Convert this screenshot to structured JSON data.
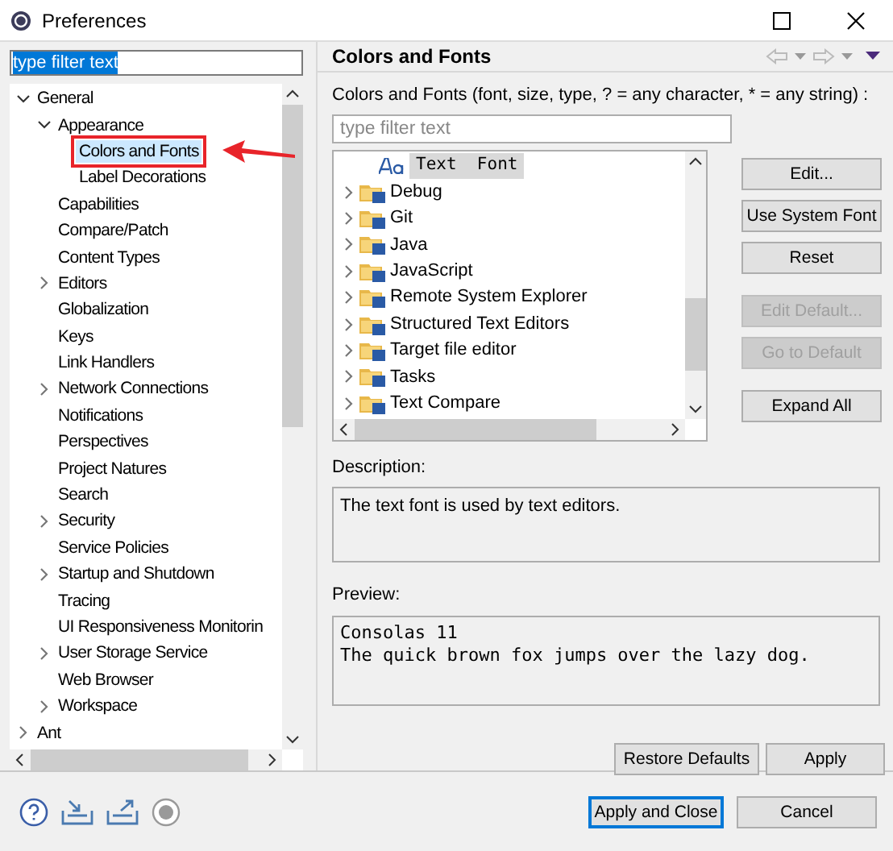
{
  "window": {
    "title": "Preferences"
  },
  "filter": {
    "value": "type filter text",
    "selected": true
  },
  "tree": [
    {
      "label": "General",
      "expanded": true,
      "selected": false,
      "children": [
        {
          "label": "Appearance",
          "expanded": true,
          "selected": false,
          "children": [
            {
              "label": "Colors and Fonts",
              "kind": "leaf",
              "selected": true
            },
            {
              "label": "Label Decorations",
              "kind": "leaf",
              "selected": false
            }
          ]
        },
        {
          "label": "Capabilities",
          "kind": "leaf",
          "selected": false
        },
        {
          "label": "Compare/Patch",
          "kind": "leaf",
          "selected": false
        },
        {
          "label": "Content Types",
          "kind": "leaf",
          "selected": false
        },
        {
          "label": "Editors",
          "expanded": false,
          "selected": false
        },
        {
          "label": "Globalization",
          "kind": "leaf",
          "selected": false
        },
        {
          "label": "Keys",
          "kind": "leaf",
          "selected": false
        },
        {
          "label": "Link Handlers",
          "kind": "leaf",
          "selected": false
        },
        {
          "label": "Network Connections",
          "expanded": false,
          "selected": false
        },
        {
          "label": "Notifications",
          "kind": "leaf",
          "selected": false
        },
        {
          "label": "Perspectives",
          "kind": "leaf",
          "selected": false
        },
        {
          "label": "Project Natures",
          "kind": "leaf",
          "selected": false
        },
        {
          "label": "Search",
          "kind": "leaf",
          "selected": false
        },
        {
          "label": "Security",
          "expanded": false,
          "selected": false
        },
        {
          "label": "Service Policies",
          "kind": "leaf",
          "selected": false
        },
        {
          "label": "Startup and Shutdown",
          "expanded": false,
          "selected": false
        },
        {
          "label": "Tracing",
          "kind": "leaf",
          "selected": false
        },
        {
          "label": "UI Responsiveness Monitorin",
          "kind": "leaf",
          "selected": false
        },
        {
          "label": "User Storage Service",
          "expanded": false,
          "selected": false
        },
        {
          "label": "Web Browser",
          "kind": "leaf",
          "selected": false
        },
        {
          "label": "Workspace",
          "expanded": false,
          "selected": false
        }
      ]
    },
    {
      "label": "Ant",
      "expanded": false,
      "selected": false
    }
  ],
  "page": {
    "title": "Colors and Fonts",
    "filter_label": "Colors and Fonts (font, size, type, ? = any character, * = any string) :",
    "filter": {
      "placeholder": "type filter text"
    },
    "fonts": [
      {
        "label": "Text  Font",
        "kind": "font",
        "selected": true
      },
      {
        "label": "Debug",
        "kind": "category",
        "selected": false
      },
      {
        "label": "Git",
        "kind": "category",
        "selected": false
      },
      {
        "label": "Java",
        "kind": "category",
        "selected": false
      },
      {
        "label": "JavaScript",
        "kind": "category",
        "selected": false
      },
      {
        "label": "Remote System Explorer",
        "kind": "category",
        "selected": false
      },
      {
        "label": "Structured Text Editors",
        "kind": "category",
        "selected": false
      },
      {
        "label": "Target file editor",
        "kind": "category",
        "selected": false
      },
      {
        "label": "Tasks",
        "kind": "category",
        "selected": false
      },
      {
        "label": "Text Compare",
        "kind": "category",
        "selected": false
      }
    ],
    "buttons": [
      {
        "label": "Edit...",
        "disabled": false
      },
      {
        "label": "Use System Font",
        "disabled": false
      },
      {
        "label": "Reset",
        "disabled": false
      },
      {
        "label": "Edit Default...",
        "disabled": true
      },
      {
        "label": "Go to Default",
        "disabled": true
      },
      {
        "label": "Expand All",
        "disabled": false
      }
    ],
    "description_label": "Description:",
    "description": "The text font is used by text editors.",
    "preview_label": "Preview:",
    "preview": [
      "Consolas 11",
      "The quick brown fox jumps over the lazy dog."
    ],
    "restore_button": "Restore Defaults",
    "apply_button": "Apply"
  },
  "footer": {
    "primary_button": "Apply and Close",
    "cancel_button": "Cancel"
  }
}
